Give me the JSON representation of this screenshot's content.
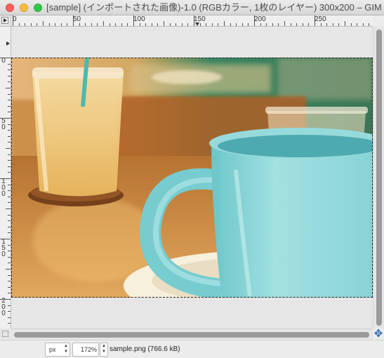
{
  "window": {
    "title": "[sample] (インポートされた画像)-1.0 (RGBカラー, 1枚のレイヤー) 300x200 – GIMP"
  },
  "rulers": {
    "horizontal_labels": [
      "0",
      "50",
      "100",
      "150",
      "200",
      "250"
    ],
    "vertical_labels": [
      "0",
      "50",
      "100",
      "150",
      "200"
    ]
  },
  "statusbar": {
    "unit": "px",
    "zoom": "172%",
    "file_info": "sample.png (766.6 kB)"
  },
  "image": {
    "description_icon": "photo-canvas",
    "colors": {
      "mug": "#7fd3dc",
      "table": "#b9773a",
      "wall_green": "#2f7f5e"
    }
  },
  "icons": {
    "navigate": "move-arrows-icon",
    "quick_mask": "quick-mask-icon",
    "ruler_menu": "menu-arrow-icon"
  }
}
